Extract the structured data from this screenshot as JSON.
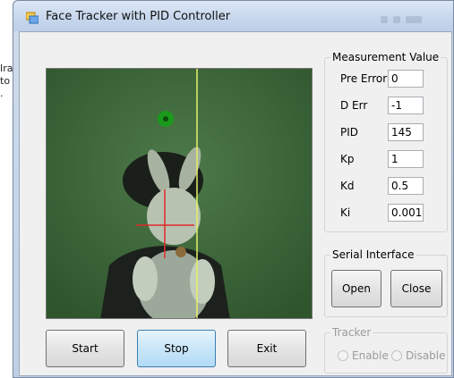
{
  "background_window": {
    "snippets": [
      "Ira",
      "to",
      "."
    ]
  },
  "window": {
    "title": "Face Tracker with PID Controller"
  },
  "camera": {},
  "buttons": {
    "start": "Start",
    "stop": "Stop",
    "exit": "Exit"
  },
  "measurement": {
    "legend": "Measurement Value",
    "fields": [
      {
        "label": "Pre Error",
        "value": "0"
      },
      {
        "label": "D Err",
        "value": "-1"
      },
      {
        "label": "PID",
        "value": "145"
      },
      {
        "label": "Kp",
        "value": "1"
      },
      {
        "label": "Kd",
        "value": "0.5"
      },
      {
        "label": "Ki",
        "value": "0.001"
      }
    ]
  },
  "serial": {
    "legend": "Serial Interface",
    "open": "Open",
    "close": "Close"
  },
  "tracker": {
    "legend": "Tracker",
    "enable": "Enable",
    "disable": "Disable"
  },
  "colors": {
    "camera_bg": "#3f6a3c",
    "crosshair": "#e02a2a",
    "vertical_line": "#e6f06a",
    "marker": "#1a9a1a"
  }
}
